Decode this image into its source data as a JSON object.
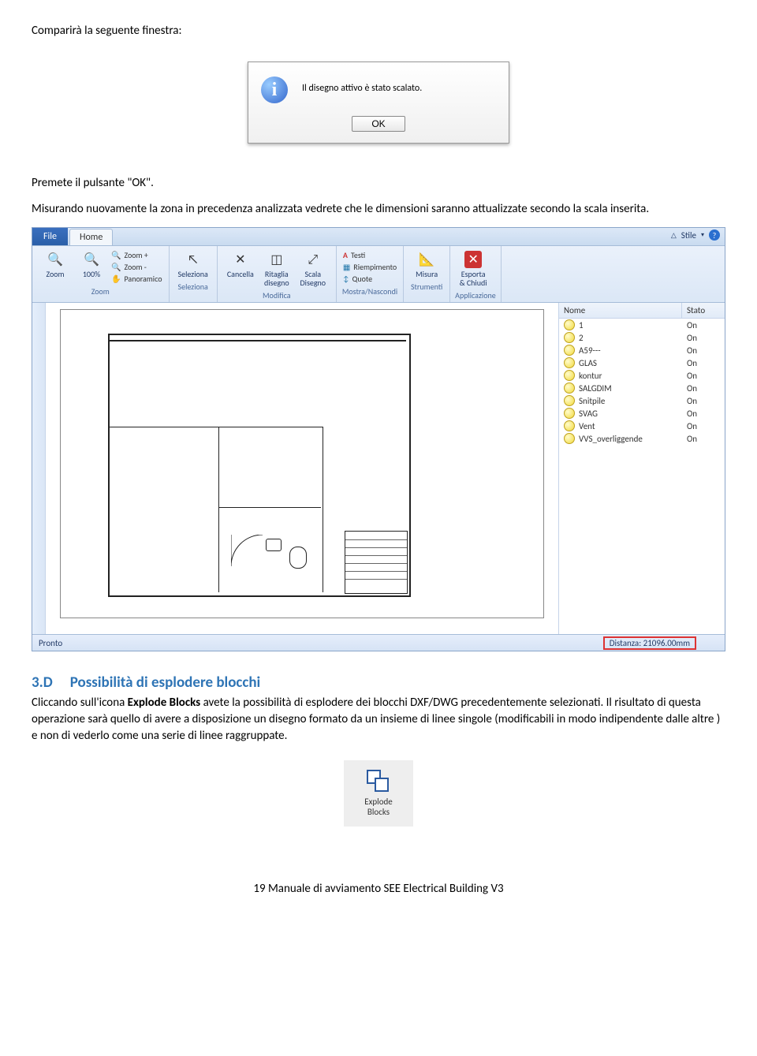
{
  "intro": "Comparirà la seguente finestra:",
  "dialog": {
    "message": "Il disegno attivo è stato scalato.",
    "ok": "OK"
  },
  "para1": "Premete il pulsante \"OK\".",
  "para2": "Misurando nuovamente la zona in precedenza analizzata vedrete che le dimensioni saranno attualizzate secondo la scala inserita.",
  "app": {
    "file": "File",
    "home": "Home",
    "stile": "Stile",
    "collapse": "△",
    "ribbon": {
      "zoom": {
        "zoom": "Zoom",
        "p100": "100%",
        "zoom_plus": "Zoom +",
        "zoom_minus": "Zoom -",
        "panoramico": "Panoramico",
        "title": "Zoom"
      },
      "seleziona": {
        "seleziona": "Seleziona",
        "title": "Seleziona"
      },
      "modifica": {
        "cancella": "Cancella",
        "ritaglia": "Ritaglia\ndisegno",
        "scala": "Scala\nDisegno",
        "title": "Modifica"
      },
      "mostra": {
        "testi": "Testi",
        "riempimento": "Riempimento",
        "quote": "Quote",
        "title": "Mostra/Nascondi"
      },
      "strumenti": {
        "misura": "Misura",
        "title": "Strumenti"
      },
      "applicazione": {
        "esporta": "Esporta\n& Chiudi",
        "title": "Applicazione"
      }
    },
    "panel": {
      "col_nome": "Nome",
      "col_stato": "Stato",
      "layers": [
        {
          "name": "1",
          "state": "On"
        },
        {
          "name": "2",
          "state": "On"
        },
        {
          "name": "A59---",
          "state": "On"
        },
        {
          "name": "GLAS",
          "state": "On"
        },
        {
          "name": "kontur",
          "state": "On"
        },
        {
          "name": "SALGDIM",
          "state": "On"
        },
        {
          "name": "Snitpile",
          "state": "On"
        },
        {
          "name": "SVAG",
          "state": "On"
        },
        {
          "name": "Vent",
          "state": "On"
        },
        {
          "name": "VVS_overliggende",
          "state": "On"
        }
      ]
    },
    "status_left": "Pronto",
    "status_right": "Distanza: 21096.00mm"
  },
  "heading": {
    "num": "3.D",
    "title": "Possibilità di esplodere blocchi"
  },
  "para3_before": "Cliccando sull'icona ",
  "para3_bold": "Explode Blocks",
  "para3_after": " avete la possibilità di esplodere dei blocchi DXF/DWG precedentemente selezionati. Il risultato di questa operazione sarà quello di avere a disposizione un disegno formato da un insieme di linee singole (modificabili in modo indipendente dalle altre ) e non di vederlo come una serie di linee raggruppate.",
  "explode": {
    "line1": "Explode",
    "line2": "Blocks"
  },
  "footer": "19  Manuale di avviamento SEE Electrical Building V3"
}
